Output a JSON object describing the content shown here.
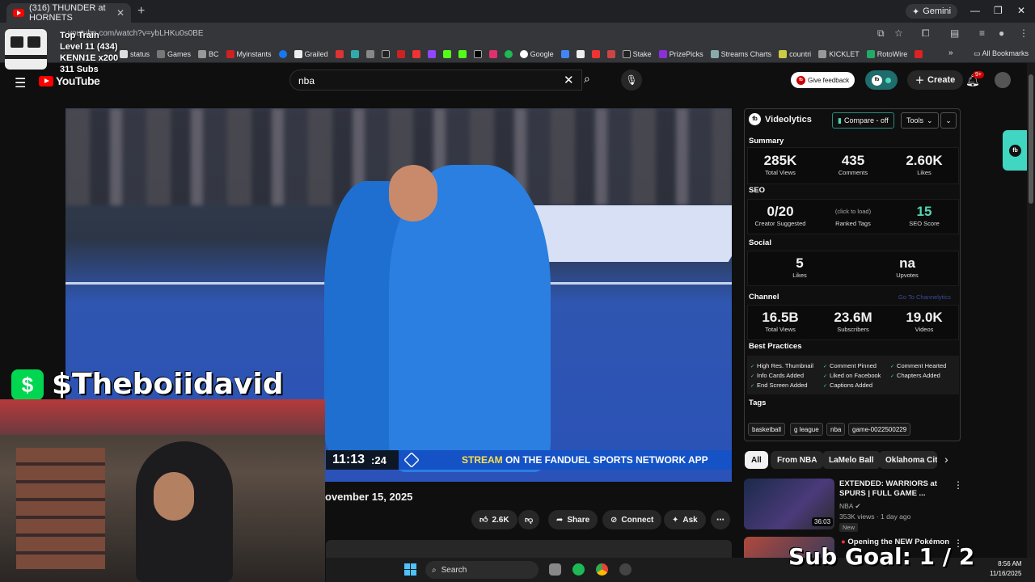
{
  "browser": {
    "tab_title": "(316) THUNDER at HORNETS",
    "gemini_label": "Gemini",
    "url": "youtube.com/watch?v=ybLHKu0s0BE",
    "all_bookmarks": "All Bookmarks",
    "bookmarks": [
      "status",
      "Games",
      "BC",
      "Myinstants",
      "Grailed",
      "Google",
      "Stake",
      "PrizePicks",
      "Streams Charts",
      "countri",
      "KICKLET",
      "RotoWire"
    ]
  },
  "youtube": {
    "logo_text": "YouTube",
    "search_value": "nba",
    "give_feedback": "Give feedback",
    "create_label": "Create",
    "notif_badge": "9+"
  },
  "video": {
    "game_clock": "11:13",
    "shot_clock": ":24",
    "stream_text_pre": "STREAM",
    "stream_text_post": " ON THE FANDUEL SPORTS NETWORK APP",
    "date_partial": "ovember 15, 2025",
    "like_count": "2.6K",
    "share": "Share",
    "connect": "Connect",
    "ask": "Ask"
  },
  "videolytics": {
    "title": "Videolytics",
    "compare": "Compare - off",
    "tools": "Tools",
    "summary_label": "Summary",
    "summary": [
      {
        "value": "285K",
        "label": "Total Views"
      },
      {
        "value": "435",
        "label": "Comments"
      },
      {
        "value": "2.60K",
        "label": "Likes"
      }
    ],
    "seo_label": "SEO",
    "seo": [
      {
        "value": "0/20",
        "label": "Creator Suggested"
      },
      {
        "value": "(click to load)",
        "label": "Ranked Tags"
      },
      {
        "value": "15",
        "label": "SEO Score"
      }
    ],
    "social_label": "Social",
    "social": [
      {
        "value": "5",
        "label": "Likes"
      },
      {
        "value": "na",
        "label": "Upvotes"
      }
    ],
    "channel_label": "Channel",
    "go_to_channelytics": "Go To Channelytics",
    "channel": [
      {
        "value": "16.5B",
        "label": "Total Views"
      },
      {
        "value": "23.6M",
        "label": "Subscribers"
      },
      {
        "value": "19.0K",
        "label": "Videos"
      }
    ],
    "best_practices_label": "Best Practices",
    "best_practices": [
      "High Res. Thumbnail",
      "Comment Pinned",
      "Comment Hearted",
      "Info Cards Added",
      "Liked on Facebook",
      "Chapters Added",
      "End Screen Added",
      "Captions Added"
    ],
    "tags_label": "Tags",
    "tags": [
      "basketball",
      "g league",
      "nba",
      "game-0022500229"
    ]
  },
  "filters": [
    "All",
    "From NBA",
    "LaMelo Ball",
    "Oklahoma Cit"
  ],
  "recommendations": [
    {
      "title": "EXTENDED: WARRIORS at SPURS | FULL GAME ...",
      "channel": "NBA",
      "meta": "353K views · 1 day ago",
      "badge": "New",
      "duration": "36:03"
    },
    {
      "title": "Opening the NEW Pokémon"
    }
  ],
  "overlay": {
    "line1": "Top Train",
    "line2": "Level 11  (434)",
    "line3": "KENN1E x200",
    "line4": "311 Subs",
    "cashtag": "$Theboiidavid",
    "cash_symbol": "$",
    "sub_goal": "Sub Goal:  1 / 2"
  },
  "taskbar": {
    "search": "Search",
    "time": "8:56 AM",
    "date": "11/16/2025"
  }
}
